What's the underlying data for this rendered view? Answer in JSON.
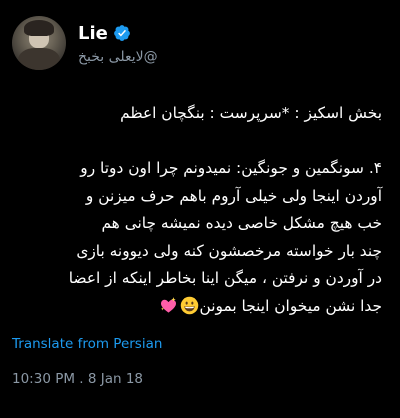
{
  "tweet": {
    "display_name": "Lie",
    "handle": "@لایعلی بخبخ",
    "verified": true,
    "line_1": "بخش اسکیز : *سرپرست : بنگچان اعظم",
    "line_2": "۴. سونگمین و جونگین: نمیدونم چرا اون دوتا رو",
    "line_3": "آوردن اینجا ولی خیلی آروم باهم حرف میزنن و",
    "line_4": "خب هیچ مشکل خاصی دیده نمیشه چانی هم",
    "line_5": "چند بار خواسته مرخصشون کنه ولی دیوونه بازی",
    "line_6": "در آوردن و نرفتن ، میگن اینا بخاطر اینکه از اعضا",
    "line_7": "جدا نشن میخوان اینجا بمونن",
    "translate_label": "Translate from Persian",
    "timestamp": "10:30 PM . 8 Jan 18"
  },
  "icons": {
    "verified": "verified-badge-icon",
    "emoji_1": "grinning-face-emoji",
    "emoji_2": "sparkling-heart-emoji"
  },
  "colors": {
    "background": "#000000",
    "text": "#ffffff",
    "secondary_text": "#8b98a5",
    "link": "#1d9bf0",
    "verified": "#1d9bf0"
  }
}
